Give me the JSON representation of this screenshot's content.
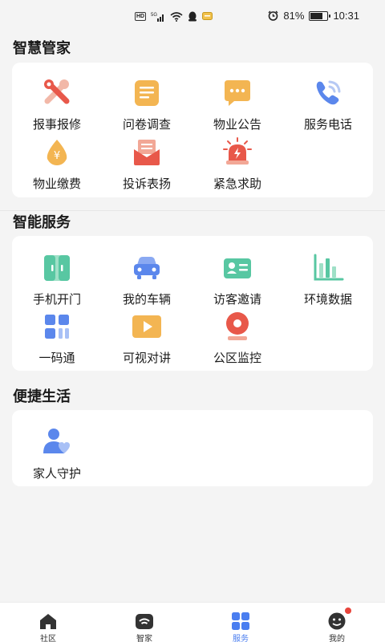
{
  "status_bar": {
    "signal_label": "5G",
    "hd_label": "HD",
    "battery": "81%",
    "battery_level": 0.81,
    "time": "10:31"
  },
  "sections": {
    "smart_butler": {
      "title": "智慧管家",
      "items": [
        {
          "label": "报事报修",
          "icon": "wrench-icon"
        },
        {
          "label": "问卷调查",
          "icon": "survey-icon"
        },
        {
          "label": "物业公告",
          "icon": "announcement-icon"
        },
        {
          "label": "服务电话",
          "icon": "phone-icon"
        },
        {
          "label": "物业缴费",
          "icon": "payment-icon"
        },
        {
          "label": "投诉表扬",
          "icon": "complaint-icon"
        },
        {
          "label": "紧急求助",
          "icon": "alarm-icon"
        }
      ]
    },
    "smart_service": {
      "title": "智能服务",
      "items": [
        {
          "label": "手机开门",
          "icon": "door-icon"
        },
        {
          "label": "我的车辆",
          "icon": "car-icon"
        },
        {
          "label": "访客邀请",
          "icon": "visitor-card-icon"
        },
        {
          "label": "环境数据",
          "icon": "bar-chart-icon"
        },
        {
          "label": "一码通",
          "icon": "qr-grid-icon"
        },
        {
          "label": "可视对讲",
          "icon": "video-play-icon"
        },
        {
          "label": "公区监控",
          "icon": "camera-icon"
        }
      ]
    },
    "convenient_life": {
      "title": "便捷生活",
      "items": [
        {
          "label": "家人守护",
          "icon": "family-guard-icon"
        }
      ]
    }
  },
  "tabbar": {
    "tabs": [
      {
        "label": "社区",
        "icon": "home-icon",
        "active": false
      },
      {
        "label": "智家",
        "icon": "smart-home-icon",
        "active": false
      },
      {
        "label": "服务",
        "icon": "grid-icon",
        "active": true
      },
      {
        "label": "我的",
        "icon": "profile-icon",
        "active": false,
        "badge": true
      }
    ]
  },
  "colors": {
    "accent": "#4a7ef0",
    "orange": "#f0b24a",
    "red": "#e8584a",
    "green": "#58c7a2",
    "blue": "#5b87ec",
    "badge": "#e8453c"
  }
}
